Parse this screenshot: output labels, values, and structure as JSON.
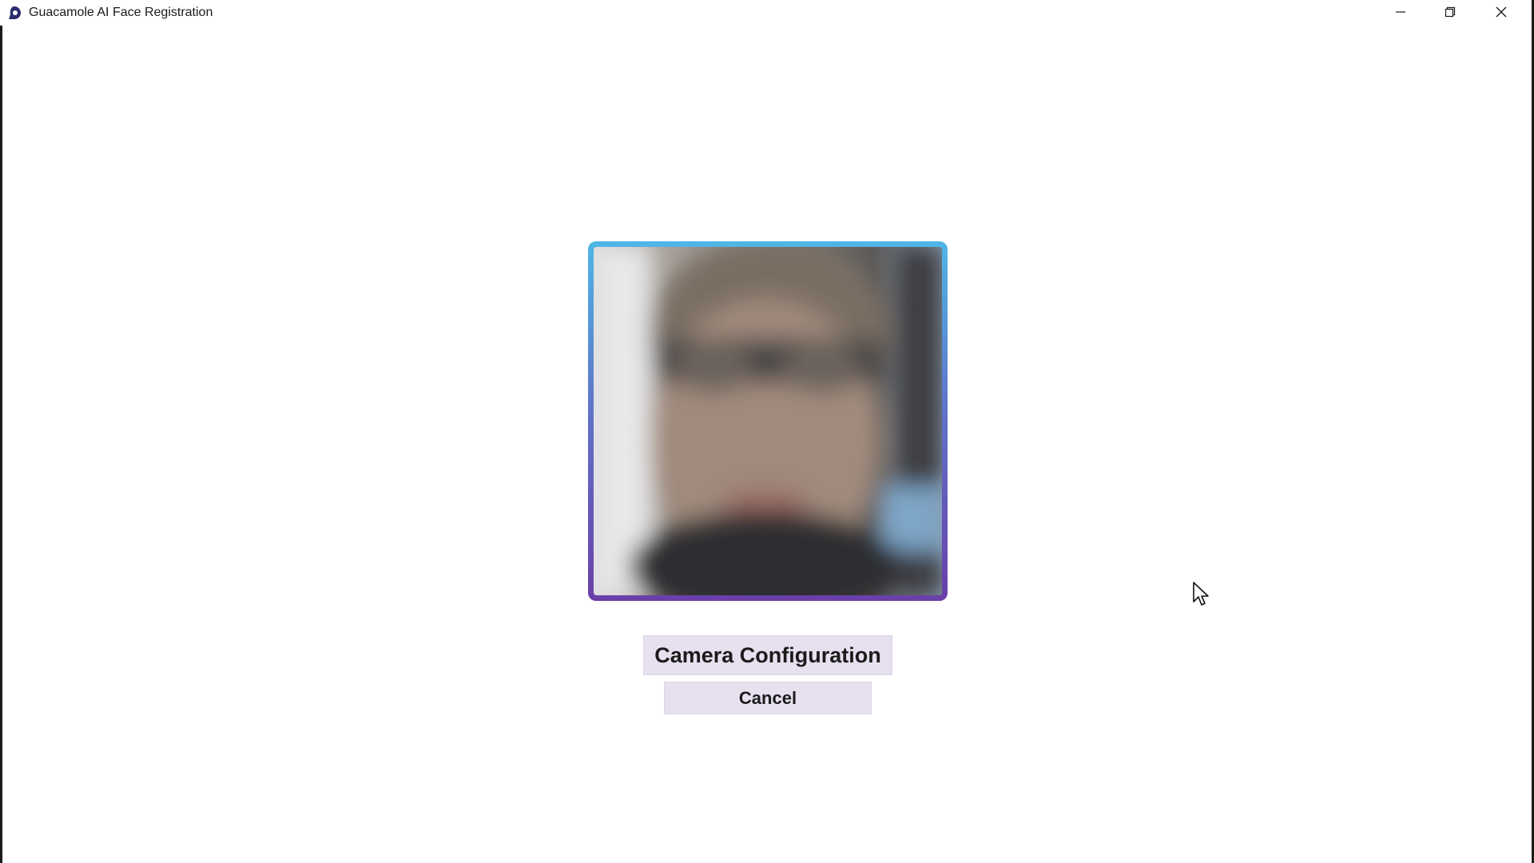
{
  "window": {
    "title": "Guacamole AI Face Registration",
    "controls": {
      "minimize_icon": "minimize-icon",
      "restore_icon": "restore-icon",
      "close_icon": "close-icon"
    }
  },
  "camera": {
    "frame_gradient_top": "#4fb6e6",
    "frame_gradient_bottom": "#6a3fa8"
  },
  "actions": {
    "camera_config_label": "Camera Configuration",
    "cancel_label": "Cancel",
    "button_bg": "#e7e0ef"
  }
}
